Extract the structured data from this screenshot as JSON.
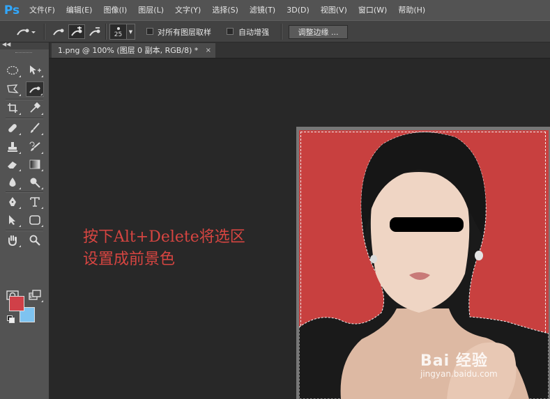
{
  "app": {
    "logo": "Ps"
  },
  "menu": [
    "文件(F)",
    "编辑(E)",
    "图像(I)",
    "图层(L)",
    "文字(Y)",
    "选择(S)",
    "滤镜(T)",
    "3D(D)",
    "视图(V)",
    "窗口(W)",
    "帮助(H)"
  ],
  "options": {
    "tool_icon": "quick-selection-icon",
    "brush_size": "25",
    "sample_all_layers_label": "对所有图层取样",
    "auto_enhance_label": "自动增强",
    "refine_edge_label": "调整边缘 ..."
  },
  "document": {
    "tab_title": "1.png @ 100% (图层 0 副本, RGB/8) *",
    "close_glyph": "×"
  },
  "colors": {
    "foreground": "#d04048",
    "background": "#7ec3f0",
    "canvas_bg": "#c8403f",
    "annotation": "#d64541"
  },
  "annotation": {
    "line1": "按下Alt+Delete将选区",
    "line2": "设置成前景色"
  },
  "watermark": {
    "main": "Bai 经验",
    "sub": "jingyan.baidu.com"
  }
}
